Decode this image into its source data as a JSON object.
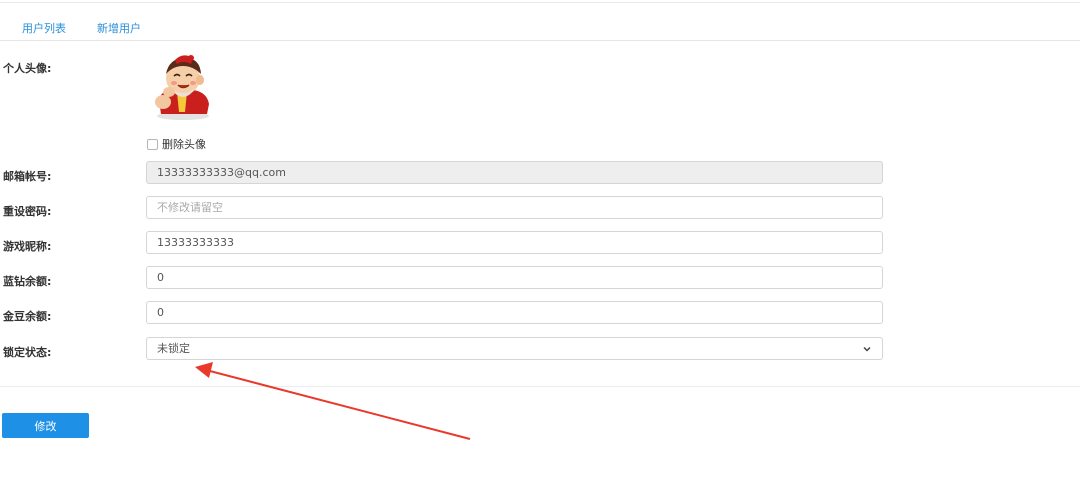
{
  "tabs": [
    {
      "label": "用户列表"
    },
    {
      "label": "新增用户"
    }
  ],
  "form": {
    "avatar": {
      "label": "个人头像:",
      "delete_checkbox_label": "删除头像",
      "delete_checked": false
    },
    "email": {
      "label": "邮箱帐号:",
      "value": "13333333333@qq.com",
      "readonly": true
    },
    "password": {
      "label": "重设密码:",
      "value": "",
      "placeholder": "不修改请留空"
    },
    "nickname": {
      "label": "游戏昵称:",
      "value": "13333333333"
    },
    "blue_diamond": {
      "label": "蓝钻余额:",
      "value": "0"
    },
    "gold_bean": {
      "label": "金豆余额:",
      "value": "0"
    },
    "lock_status": {
      "label": "锁定状态:",
      "selected": "未锁定"
    }
  },
  "submit_label": "修改",
  "colors": {
    "accent": "#1e90e6",
    "tab_text": "#2a8fd8",
    "annotation_arrow": "#e8392b"
  }
}
